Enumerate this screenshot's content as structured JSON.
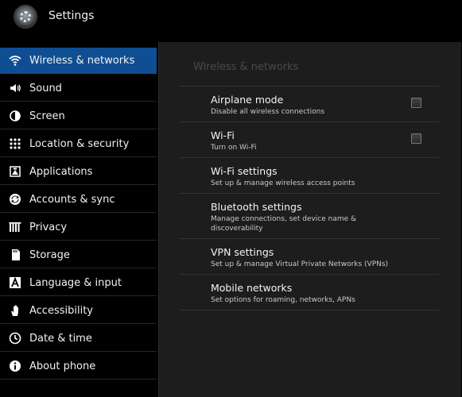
{
  "app": {
    "title": "Settings"
  },
  "sidebar": {
    "items": [
      {
        "label": "Wireless & networks",
        "icon": "wifi-icon",
        "selected": true
      },
      {
        "label": "Sound",
        "icon": "speaker-icon"
      },
      {
        "label": "Screen",
        "icon": "brightness-icon"
      },
      {
        "label": "Location & security",
        "icon": "location-grid-icon"
      },
      {
        "label": "Applications",
        "icon": "applications-icon"
      },
      {
        "label": "Accounts & sync",
        "icon": "sync-icon"
      },
      {
        "label": "Privacy",
        "icon": "privacy-icon"
      },
      {
        "label": "Storage",
        "icon": "storage-icon"
      },
      {
        "label": "Language & input",
        "icon": "language-icon"
      },
      {
        "label": "Accessibility",
        "icon": "accessibility-hand-icon"
      },
      {
        "label": "Date & time",
        "icon": "clock-icon"
      },
      {
        "label": "About phone",
        "icon": "info-icon"
      }
    ]
  },
  "panel": {
    "title": "Wireless & networks",
    "items": [
      {
        "title": "Airplane mode",
        "subtitle": "Disable all wireless connections",
        "checkbox": true,
        "checked": false
      },
      {
        "title": "Wi-Fi",
        "subtitle": "Turn on Wi-Fi",
        "checkbox": true,
        "checked": false
      },
      {
        "title": "Wi-Fi settings",
        "subtitle": "Set up & manage wireless access points"
      },
      {
        "title": "Bluetooth settings",
        "subtitle": "Manage connections, set device name & discoverability"
      },
      {
        "title": "VPN settings",
        "subtitle": "Set up & manage Virtual Private Networks (VPNs)"
      },
      {
        "title": "Mobile networks",
        "subtitle": "Set options for roaming, networks, APNs"
      }
    ]
  },
  "colors": {
    "selected_item": "#0f4e92",
    "panel_background": "#1d1d1d",
    "background": "#000000"
  }
}
